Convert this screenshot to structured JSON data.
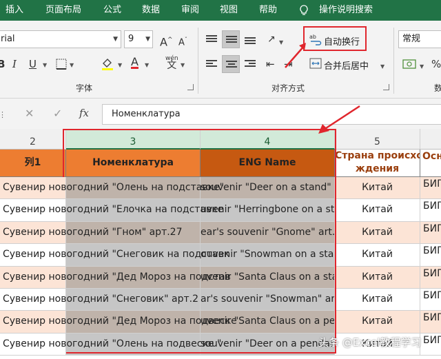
{
  "menu": [
    "插入",
    "页面布局",
    "公式",
    "数据",
    "审阅",
    "视图",
    "帮助",
    "操作说明搜索"
  ],
  "ribbon": {
    "font_name": "rial",
    "font_size": "9",
    "font_group_label": "字体",
    "align_group_label": "对齐方式",
    "wrap_text": "自动换行",
    "merge_center": "合并后居中",
    "number_format": "常规",
    "number_group_partial": "数",
    "wen_glyph": "wén",
    "wen_char": "文"
  },
  "formula_bar": {
    "fx": "fx",
    "value": "Номенклатура"
  },
  "columns": [
    "2",
    "3",
    "4",
    "5"
  ],
  "headers": [
    "列1",
    "Номенклатура",
    "ENG Name",
    "Страна происхождения",
    "Осн"
  ],
  "header_country_lines": [
    "Страна происхо",
    "ждения"
  ],
  "rows": [
    {
      "c1": "Сувенир новогодний \"Олень на подставке\"",
      "c2": "",
      "c3": "souvenir \"Deer on a stand\" ar",
      "c4": "Китай",
      "c5": "БИГ"
    },
    {
      "c1": "Сувенир новогодний \"Елочка на подставке",
      "c2": "",
      "c3": "uvenir \"Herringbone on a stand",
      "c4": "Китай",
      "c5": "БИГ"
    },
    {
      "c1": "Сувенир новогодний \"Гном\" арт.27",
      "c2": "",
      "c3": "ear's souvenir \"Gnome\" art.27",
      "c4": "Китай",
      "c5": "БИГ"
    },
    {
      "c1": "Сувенир новогодний \"Снеговик на подставк",
      "c2": "",
      "c3": "ouvenir \"Snowman on a stand\"",
      "c4": "Китай",
      "c5": "БИГ"
    },
    {
      "c1": "Сувенир новогодний \"Дед Мороз на подстав",
      "c2": "",
      "c3": "uvenir \"Santa Claus on a stand",
      "c4": "Китай",
      "c5": "БИГ"
    },
    {
      "c1": "Сувенир новогодний \"Снеговик\" арт.2",
      "c2": "",
      "c3": "ar's souvenir \"Snowman\" art.27",
      "c4": "Китай",
      "c5": "БИГ"
    },
    {
      "c1": "Сувенир новогодний \"Дед Мороз на подвеске",
      "c2": "",
      "c3": "uvenir \"Santa Claus on a penda",
      "c4": "Китай",
      "c5": "БИГ"
    },
    {
      "c1": "Сувенир новогодний \"Олень на подвеске \"",
      "c2": "",
      "c3": "souvenir \"Deer on a pendan",
      "c4": "Китай",
      "c5": "БИГ"
    }
  ],
  "watermark": "头条 @Excel教程学习",
  "colors": {
    "menu_bg": "#217346",
    "orange_header": "#ED7D31",
    "brown_header": "#C65911",
    "row_peach": "#FCE4D6",
    "selected_fill": "#C6C6C6",
    "selected_fill_alt": "#BFB3AA",
    "highlight_red": "#E0262D"
  }
}
